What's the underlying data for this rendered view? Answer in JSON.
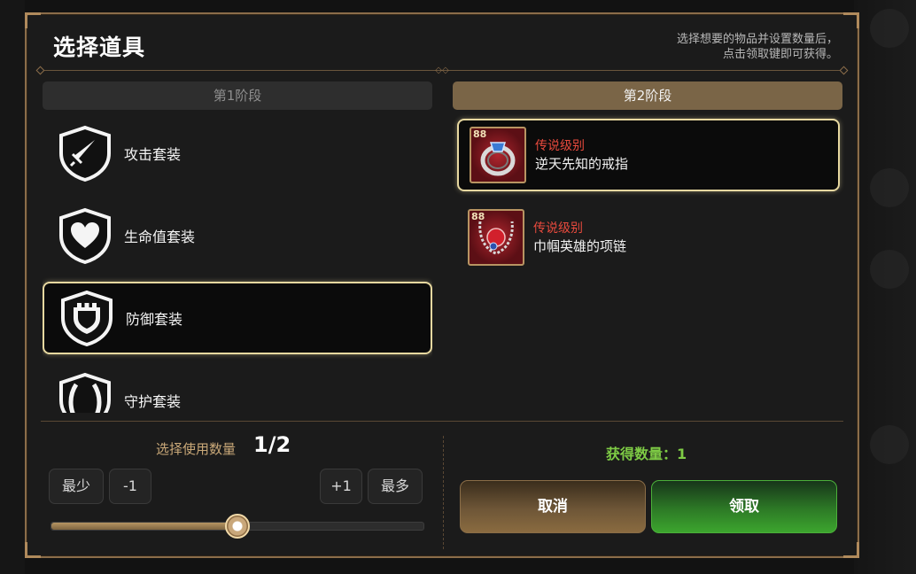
{
  "dialog": {
    "title": "选择道具",
    "hint_line1": "选择想要的物品并设置数量后，",
    "hint_line2": "点击领取键即可获得。"
  },
  "stages": [
    {
      "label": "第1阶段",
      "active": false
    },
    {
      "label": "第2阶段",
      "active": true
    }
  ],
  "sets": [
    {
      "label": "攻击套装",
      "icon": "sword-shield-icon",
      "selected": false
    },
    {
      "label": "生命值套装",
      "icon": "heart-shield-icon",
      "selected": false
    },
    {
      "label": "防御套装",
      "icon": "castle-shield-icon",
      "selected": true
    },
    {
      "label": "守护套装",
      "icon": "guard-shield-icon",
      "selected": false
    }
  ],
  "rewards": [
    {
      "level": "88",
      "grade": "传说级别",
      "name": "逆天先知的戒指",
      "icon": "ring-icon",
      "selected": true
    },
    {
      "level": "88",
      "grade": "传说级别",
      "name": "巾帼英雄的项链",
      "icon": "necklace-icon",
      "selected": false
    }
  ],
  "quantity": {
    "label": "选择使用数量",
    "value": "1/2",
    "fraction": 0.5,
    "min_label": "最少",
    "minus_label": "-1",
    "plus_label": "+1",
    "max_label": "最多"
  },
  "gain": {
    "text": "获得数量：1"
  },
  "actions": {
    "cancel": "取消",
    "claim": "领取"
  },
  "colors": {
    "accent_gold": "#8b6d4a",
    "grade_red": "#e84a3d",
    "gain_green": "#7ecb45"
  }
}
